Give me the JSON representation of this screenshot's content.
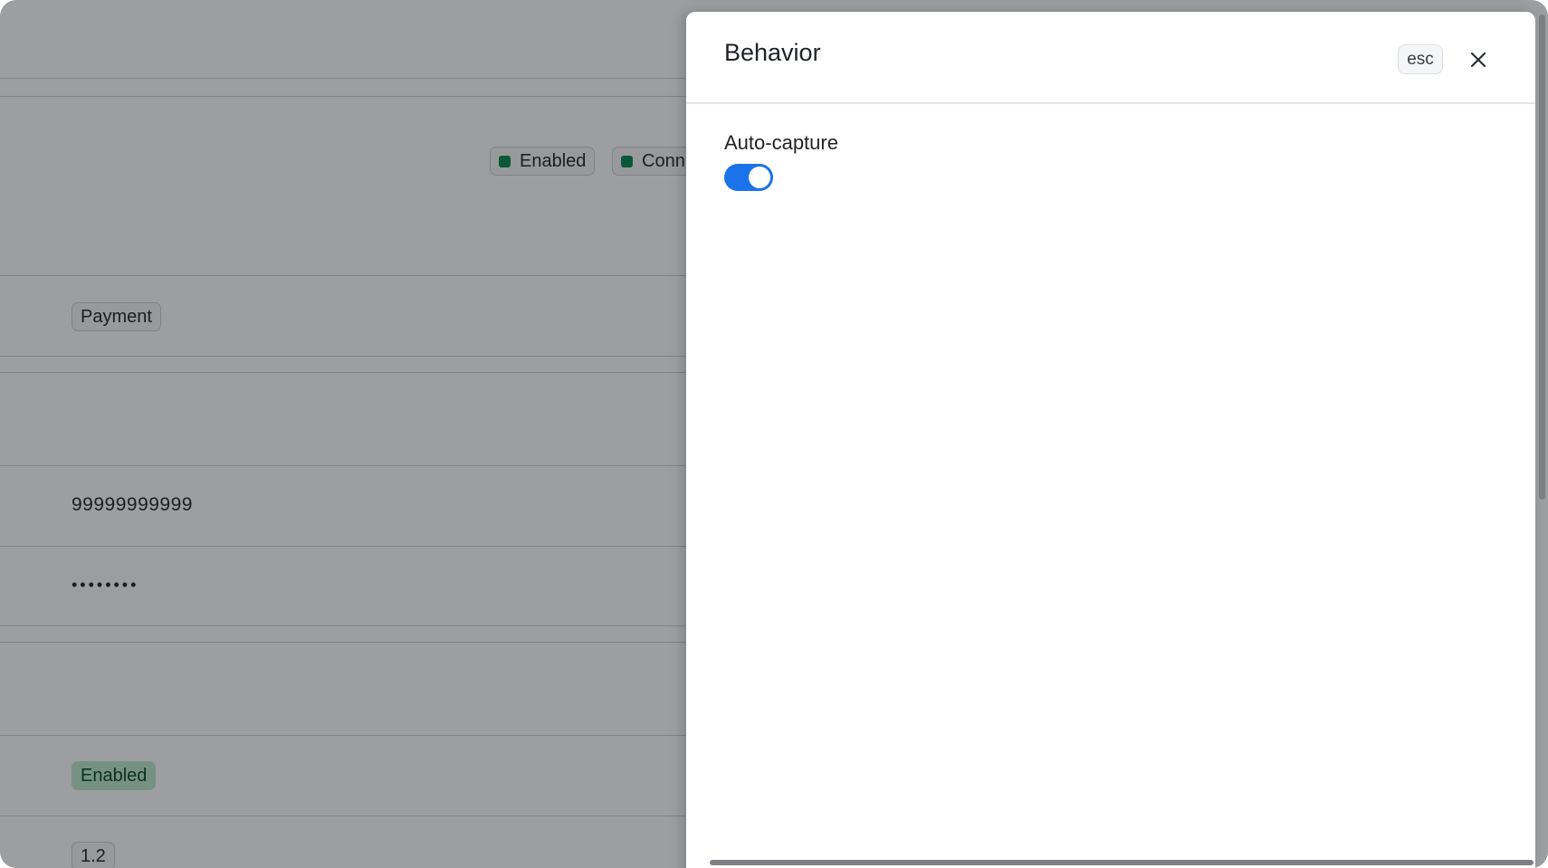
{
  "background": {
    "status_chips": [
      {
        "label": "Enabled"
      },
      {
        "label": "Conn"
      }
    ],
    "rows": {
      "type_chip": "Payment",
      "phone_value": "99999999999",
      "secret_value": "••••••••",
      "status_chip": "Enabled",
      "version_chip": "1.2"
    }
  },
  "drawer": {
    "title": "Behavior",
    "esc_label": "esc",
    "fields": [
      {
        "label": "Auto-capture",
        "enabled": true
      }
    ]
  },
  "colors": {
    "toggle_on": "#1a73e8",
    "status_dot": "#0f8a5b",
    "overlay": "rgba(0,0,0,0.36)"
  }
}
